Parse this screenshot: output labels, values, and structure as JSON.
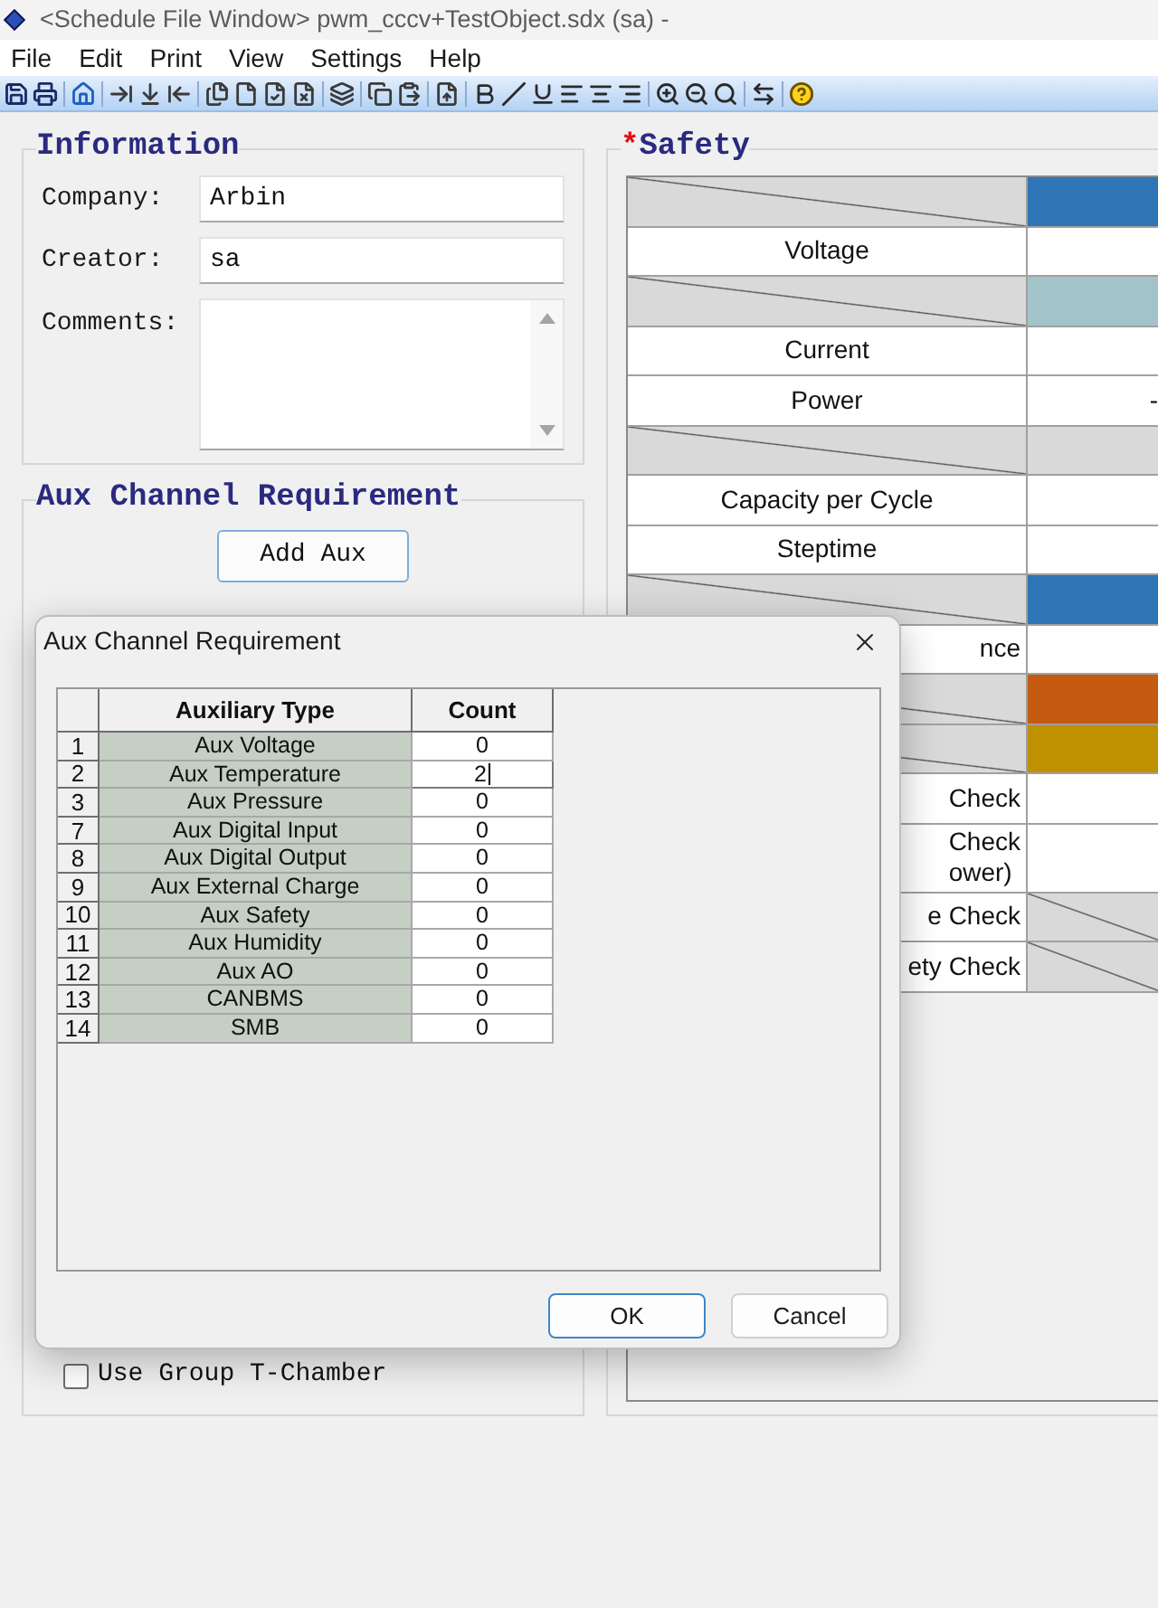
{
  "window": {
    "title": "<Schedule File Window> pwm_cccv+TestObject.sdx (sa) -"
  },
  "menu": [
    "File",
    "Edit",
    "Print",
    "View",
    "Settings",
    "Help"
  ],
  "information": {
    "title": "Information",
    "fields": [
      {
        "kind": "text",
        "label": "Company:",
        "value": "Arbin"
      },
      {
        "kind": "text",
        "label": "Creator:",
        "value": "sa"
      },
      {
        "kind": "multiline",
        "label": "Comments:"
      }
    ]
  },
  "aux_channel_requirement": {
    "title": "Aux Channel Requirement",
    "add_button": "Add Aux",
    "option": {
      "label": "Use Group T-Chamber",
      "checked": false
    }
  },
  "safety": {
    "required_mark": "*",
    "title": "Safety",
    "rows": [
      {
        "kind": "section",
        "color": "#2e75b6"
      },
      {
        "kind": "item",
        "label": "Voltage"
      },
      {
        "kind": "section",
        "color": "#a2c4c9"
      },
      {
        "kind": "item",
        "label": "Current"
      },
      {
        "kind": "item",
        "label": "Power",
        "value": "-"
      },
      {
        "kind": "section",
        "color": "#dadada"
      },
      {
        "kind": "item",
        "label": "Capacity per Cycle"
      },
      {
        "kind": "item",
        "label": "Steptime"
      },
      {
        "kind": "section",
        "color": "#2e75b6"
      },
      {
        "kind": "item",
        "label": "nce"
      },
      {
        "kind": "section",
        "color": "#c55a11"
      },
      {
        "kind": "section",
        "color": "#bf9000"
      },
      {
        "kind": "item",
        "label": "Check"
      },
      {
        "kind": "item",
        "lines": [
          "Check",
          "ower)"
        ]
      },
      {
        "kind": "unavailable",
        "label": "e Check"
      },
      {
        "kind": "unavailable",
        "label": "ety Check"
      }
    ]
  },
  "dialog": {
    "title": "Aux Channel Requirement",
    "columns": [
      "Auxiliary Type",
      "Count"
    ],
    "rows": [
      {
        "index": "1",
        "type": "Aux Voltage",
        "count": "0",
        "editing": false
      },
      {
        "index": "2",
        "type": "Aux Temperature",
        "count": "2",
        "editing": true
      },
      {
        "index": "3",
        "type": "Aux Pressure",
        "count": "0",
        "editing": false
      },
      {
        "index": "7",
        "type": "Aux Digital Input",
        "count": "0",
        "editing": false
      },
      {
        "index": "8",
        "type": "Aux Digital Output",
        "count": "0",
        "editing": false
      },
      {
        "index": "9",
        "type": "Aux External Charge",
        "count": "0",
        "editing": false
      },
      {
        "index": "10",
        "type": "Aux Safety",
        "count": "0",
        "editing": false
      },
      {
        "index": "11",
        "type": "Aux Humidity",
        "count": "0",
        "editing": false
      },
      {
        "index": "12",
        "type": "Aux AO",
        "count": "0",
        "editing": false
      },
      {
        "index": "13",
        "type": "CANBMS",
        "count": "0",
        "editing": false
      },
      {
        "index": "14",
        "type": "SMB",
        "count": "0",
        "editing": false
      }
    ],
    "buttons": [
      {
        "label": "OK",
        "default": true
      },
      {
        "label": "Cancel",
        "default": false
      }
    ]
  }
}
